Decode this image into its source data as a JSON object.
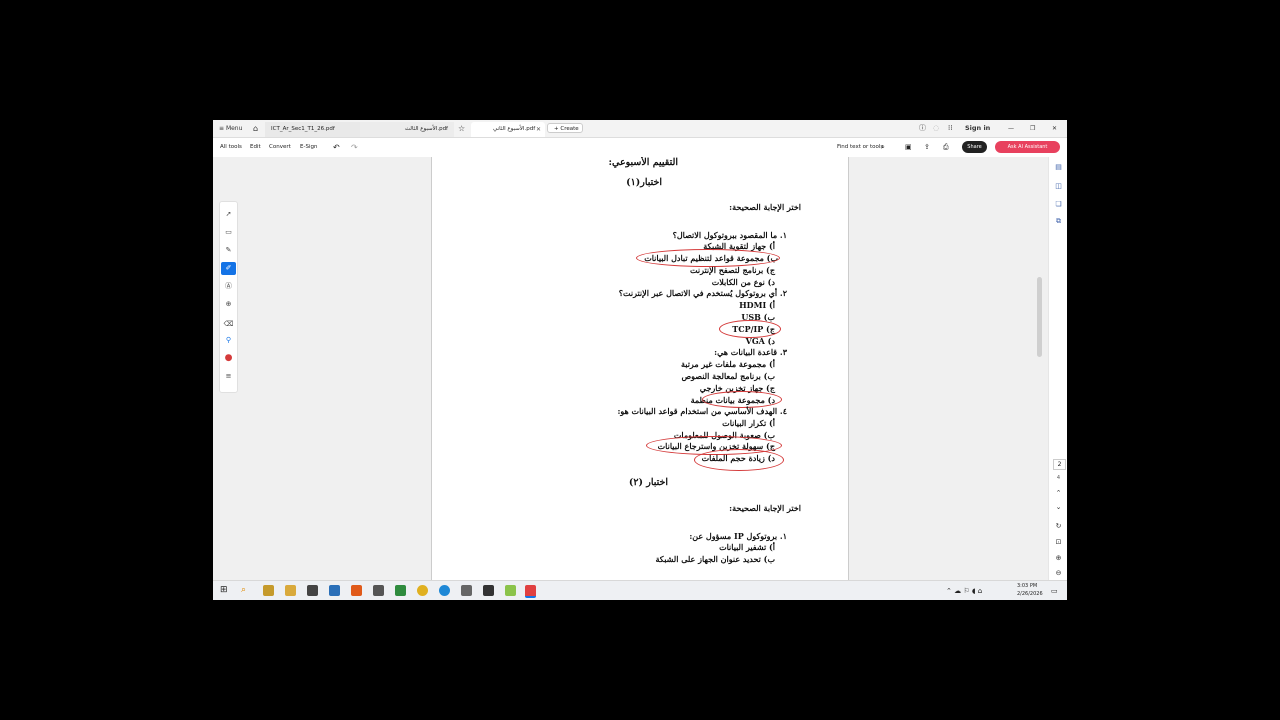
{
  "titlebar": {
    "menu_label": "Menu",
    "tabs": [
      {
        "label": "ICT_Ar_Sec1_T1_26.pdf"
      },
      {
        "label": "الأسبوع الثالث.pdf"
      },
      {
        "label": "الأسبوع الثاني.pdf"
      }
    ],
    "create_label": "+ Create",
    "sign_in": "Sign in"
  },
  "toolbar": {
    "all_tools": "All tools",
    "edit": "Edit",
    "convert": "Convert",
    "esign": "E-Sign",
    "find": "Find text or tools",
    "share": "Share",
    "ask_ai": "Ask AI Assistant"
  },
  "document": {
    "heading": "التقييم الأسبوعي:",
    "quiz1": "اختبار(١)",
    "instruction1": "اختر الإجابة الصحيحة:",
    "q1": "١. ما المقصود ببروتوكول الاتصال؟",
    "q1a": "أ) جهاز لتقوية الشبكة",
    "q1b": "ب) مجموعة قواعد لتنظيم تبادل البيانات",
    "q1c": "ج) برنامج لتصفح الإنترنت",
    "q1d": "د) نوع من الكابلات",
    "q2": "٢. أي بروتوكول يُستخدم في الاتصال عبر الإنترنت؟",
    "q2a": "أ) HDMI",
    "q2b": "ب) USB",
    "q2c": "ج) TCP/IP",
    "q2d": "د) VGA",
    "q3": "٣. قاعدة البيانات هي:",
    "q3a": "أ) مجموعة ملفات غير مرتبة",
    "q3b": "ب) برنامج لمعالجة النصوص",
    "q3c": "ج) جهاز تخزين خارجي",
    "q3d": "د) مجموعة بيانات منظمة",
    "q4": "٤. الهدف الأساسي من استخدام قواعد البيانات هو:",
    "q4a": "أ) تكرار البيانات",
    "q4b": "ب) صعوبة الوصول للمعلومات",
    "q4c": "ج) سهولة تخزين واسترجاع البيانات",
    "q4d": "د) زيادة حجم الملفات",
    "quiz2": "اختبار (٢)",
    "instruction2": "اختر الإجابة الصحيحة:",
    "q5": "١. بروتوكول IP مسؤول عن:",
    "q5a": "أ) تشفير البيانات",
    "q5b": "ب) تحديد عنوان الجهاز على الشبكة"
  },
  "rightrail": {
    "page_current": "2",
    "page_total": "4"
  },
  "taskbar": {
    "time": "3:03 PM",
    "date": "2/26/2026"
  },
  "colors": {
    "accent": "#1473e6",
    "ai": "#e8415e",
    "annotation": "#d43a3a"
  }
}
